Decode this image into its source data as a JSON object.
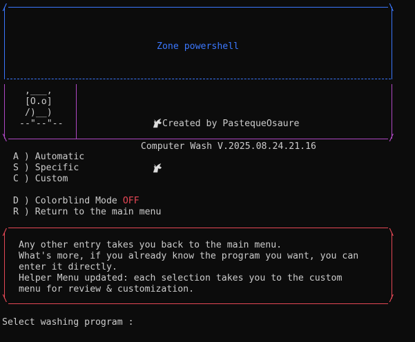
{
  "header": {
    "zone_title": "Zone powershell",
    "app_title": "Computer Wash V.2025.08.24.21.16",
    "title_icon": "unicorn-icon",
    "author_line": "Created by PastequeOsaure",
    "mascot": {
      "line1": " ,___,",
      "line2": " [O.o]",
      "line3": " /)__)",
      "line4": "--\"--\"--"
    }
  },
  "menu": {
    "items": [
      {
        "key": "A",
        "label": "Automatic"
      },
      {
        "key": "S",
        "label": "Specific"
      },
      {
        "key": "C",
        "label": "Custom"
      },
      {
        "key": "D",
        "label": "Colorblind Mode",
        "status": "OFF"
      },
      {
        "key": "R",
        "label": "Return to the main menu"
      }
    ]
  },
  "info": {
    "line1": "Any other entry takes you back to the main menu.",
    "line2": "What's more, if you already know the program you want, you can",
    "line3": "enter it directly.",
    "line4": "Helper Menu updated: each selection takes you to the custom",
    "line5": "menu for review & customization."
  },
  "prompt": {
    "text": "Select washing program :"
  },
  "colors": {
    "background": "#0c0c0c",
    "text": "#cccccc",
    "header_border": "#3b78ff",
    "title_box_border": "#b148c6",
    "info_border": "#e74856",
    "status_off": "#e74856"
  }
}
